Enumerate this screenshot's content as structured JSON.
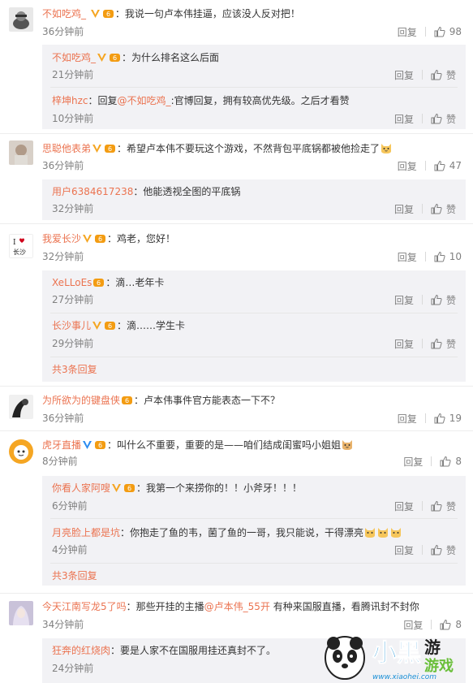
{
  "comments": [
    {
      "user": "不如吃鸡_",
      "text": "我说一句卢本伟挂逼，应该没人反对把！",
      "time": "36分钟前",
      "reply_label": "回复",
      "likes": "98",
      "replies": [
        {
          "user": "不如吃鸡_",
          "text": "为什么排名这么后面",
          "time": "21分钟前",
          "reply_label": "回复",
          "likes": "赞"
        },
        {
          "user": "梓坤hzc",
          "pre": "回复",
          "mention": "@不如吃鸡_",
          "text": ":官博回复，拥有较高优先级。之后才看赞",
          "time": "10分钟前",
          "reply_label": "回复",
          "likes": "赞"
        }
      ]
    },
    {
      "user": "思聪他表弟",
      "text": "希望卢本伟不要玩这个游戏，不然背包平底锅都被他捡走了",
      "time": "36分钟前",
      "reply_label": "回复",
      "likes": "47",
      "replies": [
        {
          "user": "用户6384617238",
          "text": "他能透视全图的平底锅",
          "time": "32分钟前",
          "reply_label": "回复",
          "likes": "赞"
        }
      ]
    },
    {
      "user": "我爱长沙",
      "text": "鸡老，您好！",
      "time": "32分钟前",
      "reply_label": "回复",
      "likes": "10",
      "replies": [
        {
          "user": "XeLLoEs",
          "text": "滴…老年卡",
          "time": "27分钟前",
          "reply_label": "回复",
          "likes": "赞"
        },
        {
          "user": "长沙事儿",
          "text": "滴……学生卡",
          "time": "29分钟前",
          "reply_label": "回复",
          "likes": "赞"
        }
      ],
      "more": "共3条回复"
    },
    {
      "user": "为所欲为的键盘侠",
      "text": "卢本伟事件官方能表态一下不？",
      "time": "36分钟前",
      "reply_label": "回复",
      "likes": "19"
    },
    {
      "user": "虎牙直播",
      "text": "叫什么不重要，重要的是——咱们结成闺蜜吗小姐姐",
      "time": "8分钟前",
      "reply_label": "回复",
      "likes": "8",
      "replies": [
        {
          "user": "你看人家阿嗖",
          "text": "我第一个来捞你的！！小斧牙！！！",
          "time": "6分钟前",
          "reply_label": "回复",
          "likes": "赞"
        },
        {
          "user": "月亮脸上都是坑",
          "text": "你抱走了鱼的韦，菌了鱼的一哥，我只能说，干得漂亮",
          "time": "4分钟前",
          "reply_label": "回复",
          "likes": "赞"
        }
      ],
      "more": "共3条回复"
    },
    {
      "user": "今天江南写龙5了吗",
      "text": "那些开挂的主播",
      "mention": "@卢本伟_55开",
      "text2": " 有种来国服直播，看腾讯封不封你",
      "time": "34分钟前",
      "reply_label": "回复",
      "likes": "8",
      "replies": [
        {
          "user": "狂奔的红烧肉",
          "text": "要是人家不在国服用挂还真封不了。",
          "time": "24分钟前"
        }
      ]
    }
  ],
  "watermark": {
    "brand": "小黑游戏",
    "url": "www.xiaohei.com"
  },
  "colors": {
    "username": "#eb7350",
    "subbox_bg": "#f2f2f5",
    "time": "#808080"
  }
}
